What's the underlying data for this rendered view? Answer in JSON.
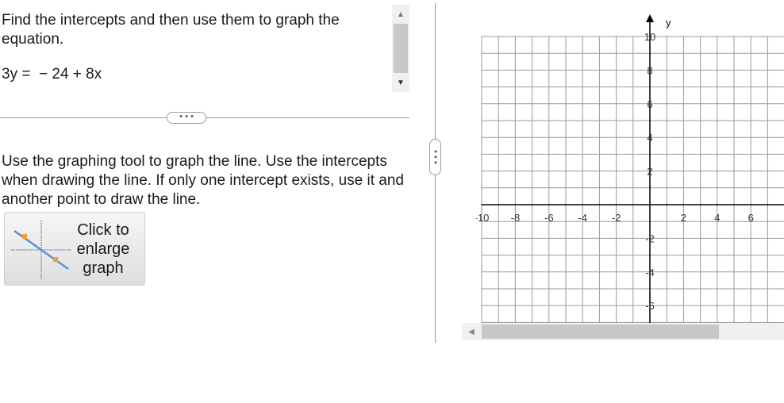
{
  "question": {
    "prompt": "Find the intercepts and then use them to graph the equation.",
    "equation": "3y =  − 24 + 8x",
    "splitter_label": "• • •"
  },
  "instructions": {
    "text": "Use the graphing tool to graph the line. Use the intercepts when drawing the line. If only one intercept exists, use it and another point to draw the line.",
    "enlarge_button_label": "Click to enlarge graph"
  },
  "vertical_splitter_label": "• • •",
  "graph": {
    "y_axis_label": "y",
    "x_tick_labels": [
      "-10",
      "-8",
      "-6",
      "-4",
      "-2",
      "2",
      "4",
      "6"
    ],
    "y_tick_labels": [
      "10",
      "8",
      "6",
      "4",
      "2",
      "-2",
      "-4",
      "-6"
    ],
    "grid_color": "#9a9a9a",
    "axis_color": "#000000"
  },
  "icons": {
    "scroll_up": "triangle-up-icon",
    "scroll_down": "triangle-down-icon",
    "scroll_left": "triangle-left-icon",
    "graph_thumbnail": "line-graph-icon"
  }
}
